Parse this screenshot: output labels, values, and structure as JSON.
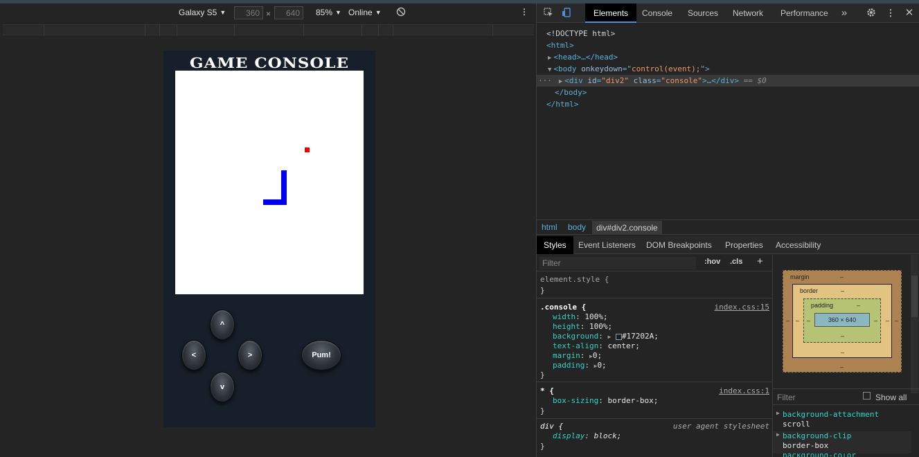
{
  "device_toolbar": {
    "device": "Galaxy S5",
    "width": "360",
    "height": "640",
    "times": "×",
    "zoom": "85%",
    "network": "Online"
  },
  "game": {
    "title": "GAME CONSOLE",
    "buttons": {
      "up": "^",
      "left": "<",
      "right": ">",
      "down": "v",
      "action": "Pum!"
    },
    "colors": {
      "body": "#17202A",
      "screen": "#ffffff",
      "snake": "#0000ee",
      "food": "#ee0000"
    }
  },
  "devtools": {
    "tabs": [
      "Elements",
      "Console",
      "Sources",
      "Network",
      "Performance"
    ],
    "more": "»",
    "dom": {
      "doctype": "<!DOCTYPE html>",
      "html_open": "<html>",
      "head": "<head>…</head>",
      "body_tag": "<body ",
      "body_attr": "onkeydown",
      "body_eq": "=\"",
      "body_val": "control(event);",
      "body_close_q": "\">",
      "div_open": "<div ",
      "div_id_attr": "id",
      "div_id_val": "\"div2\"",
      "div_class_attr": "class",
      "div_class_val": "\"console\"",
      "div_rest": ">…</div>",
      "div_eq0": " == $0",
      "body_end": "</body>",
      "html_end": "</html>",
      "ellipsis": "···"
    },
    "breadcrumbs": [
      "html",
      "body",
      "div#div2.console"
    ],
    "subtabs": [
      "Styles",
      "Event Listeners",
      "DOM Breakpoints",
      "Properties",
      "Accessibility"
    ],
    "styles": {
      "filter_placeholder": "Filter",
      "hov": ":hov",
      "cls": ".cls",
      "add": "+",
      "element_style": "element.style {",
      "close_brace": "}",
      "console_selector": ".console {",
      "console_src": "index.css:15",
      "props": [
        {
          "name": "width",
          "value": "100%;"
        },
        {
          "name": "height",
          "value": "100%;"
        },
        {
          "name": "background",
          "value": "#17202A;"
        },
        {
          "name": "text-align",
          "value": "center;"
        },
        {
          "name": "margin",
          "value": "0;"
        },
        {
          "name": "padding",
          "value": "0;"
        }
      ],
      "star_selector": "* {",
      "star_src": "index.css:1",
      "star_prop": {
        "name": "box-sizing",
        "value": "border-box;"
      },
      "div_selector": "div {",
      "div_src": "user agent stylesheet",
      "div_prop": {
        "name": "display",
        "value": "block;"
      }
    },
    "box_model": {
      "margin": "margin",
      "border": "border",
      "padding": "padding",
      "dash": "–",
      "content": "360 × 640"
    },
    "computed": {
      "filter": "Filter",
      "show_all": "Show all",
      "items": [
        {
          "name": "background-attachment",
          "value": "scroll"
        },
        {
          "name": "background-clip",
          "value": "border-box"
        },
        {
          "name": "background-color",
          "value": ""
        }
      ]
    }
  }
}
